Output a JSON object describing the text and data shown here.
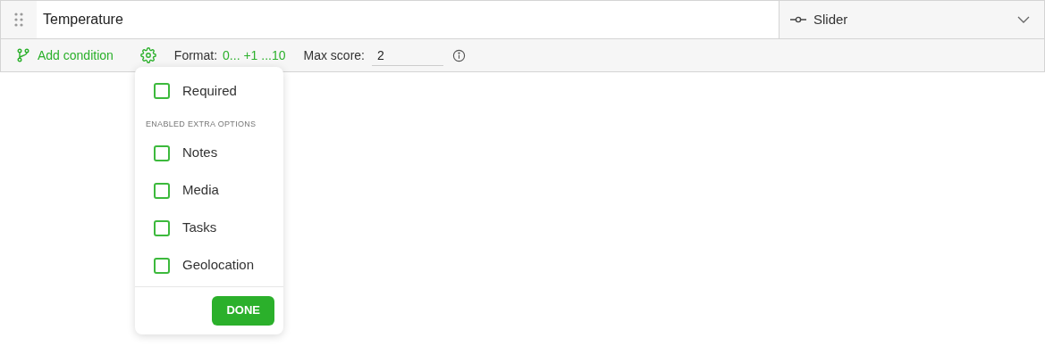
{
  "question": {
    "title": "Temperature",
    "response_type": "Slider"
  },
  "toolbar": {
    "add_condition": "Add condition",
    "format_label": "Format:",
    "format_value": "0... +1 ...10",
    "max_score_label": "Max score:",
    "max_score_value": "2"
  },
  "popover": {
    "required": {
      "label": "Required",
      "checked": false
    },
    "section_heading": "ENABLED EXTRA OPTIONS",
    "options": [
      {
        "label": "Notes",
        "checked": false
      },
      {
        "label": "Media",
        "checked": false
      },
      {
        "label": "Tasks",
        "checked": false
      },
      {
        "label": "Geolocation",
        "checked": false
      }
    ],
    "done": "DONE"
  }
}
